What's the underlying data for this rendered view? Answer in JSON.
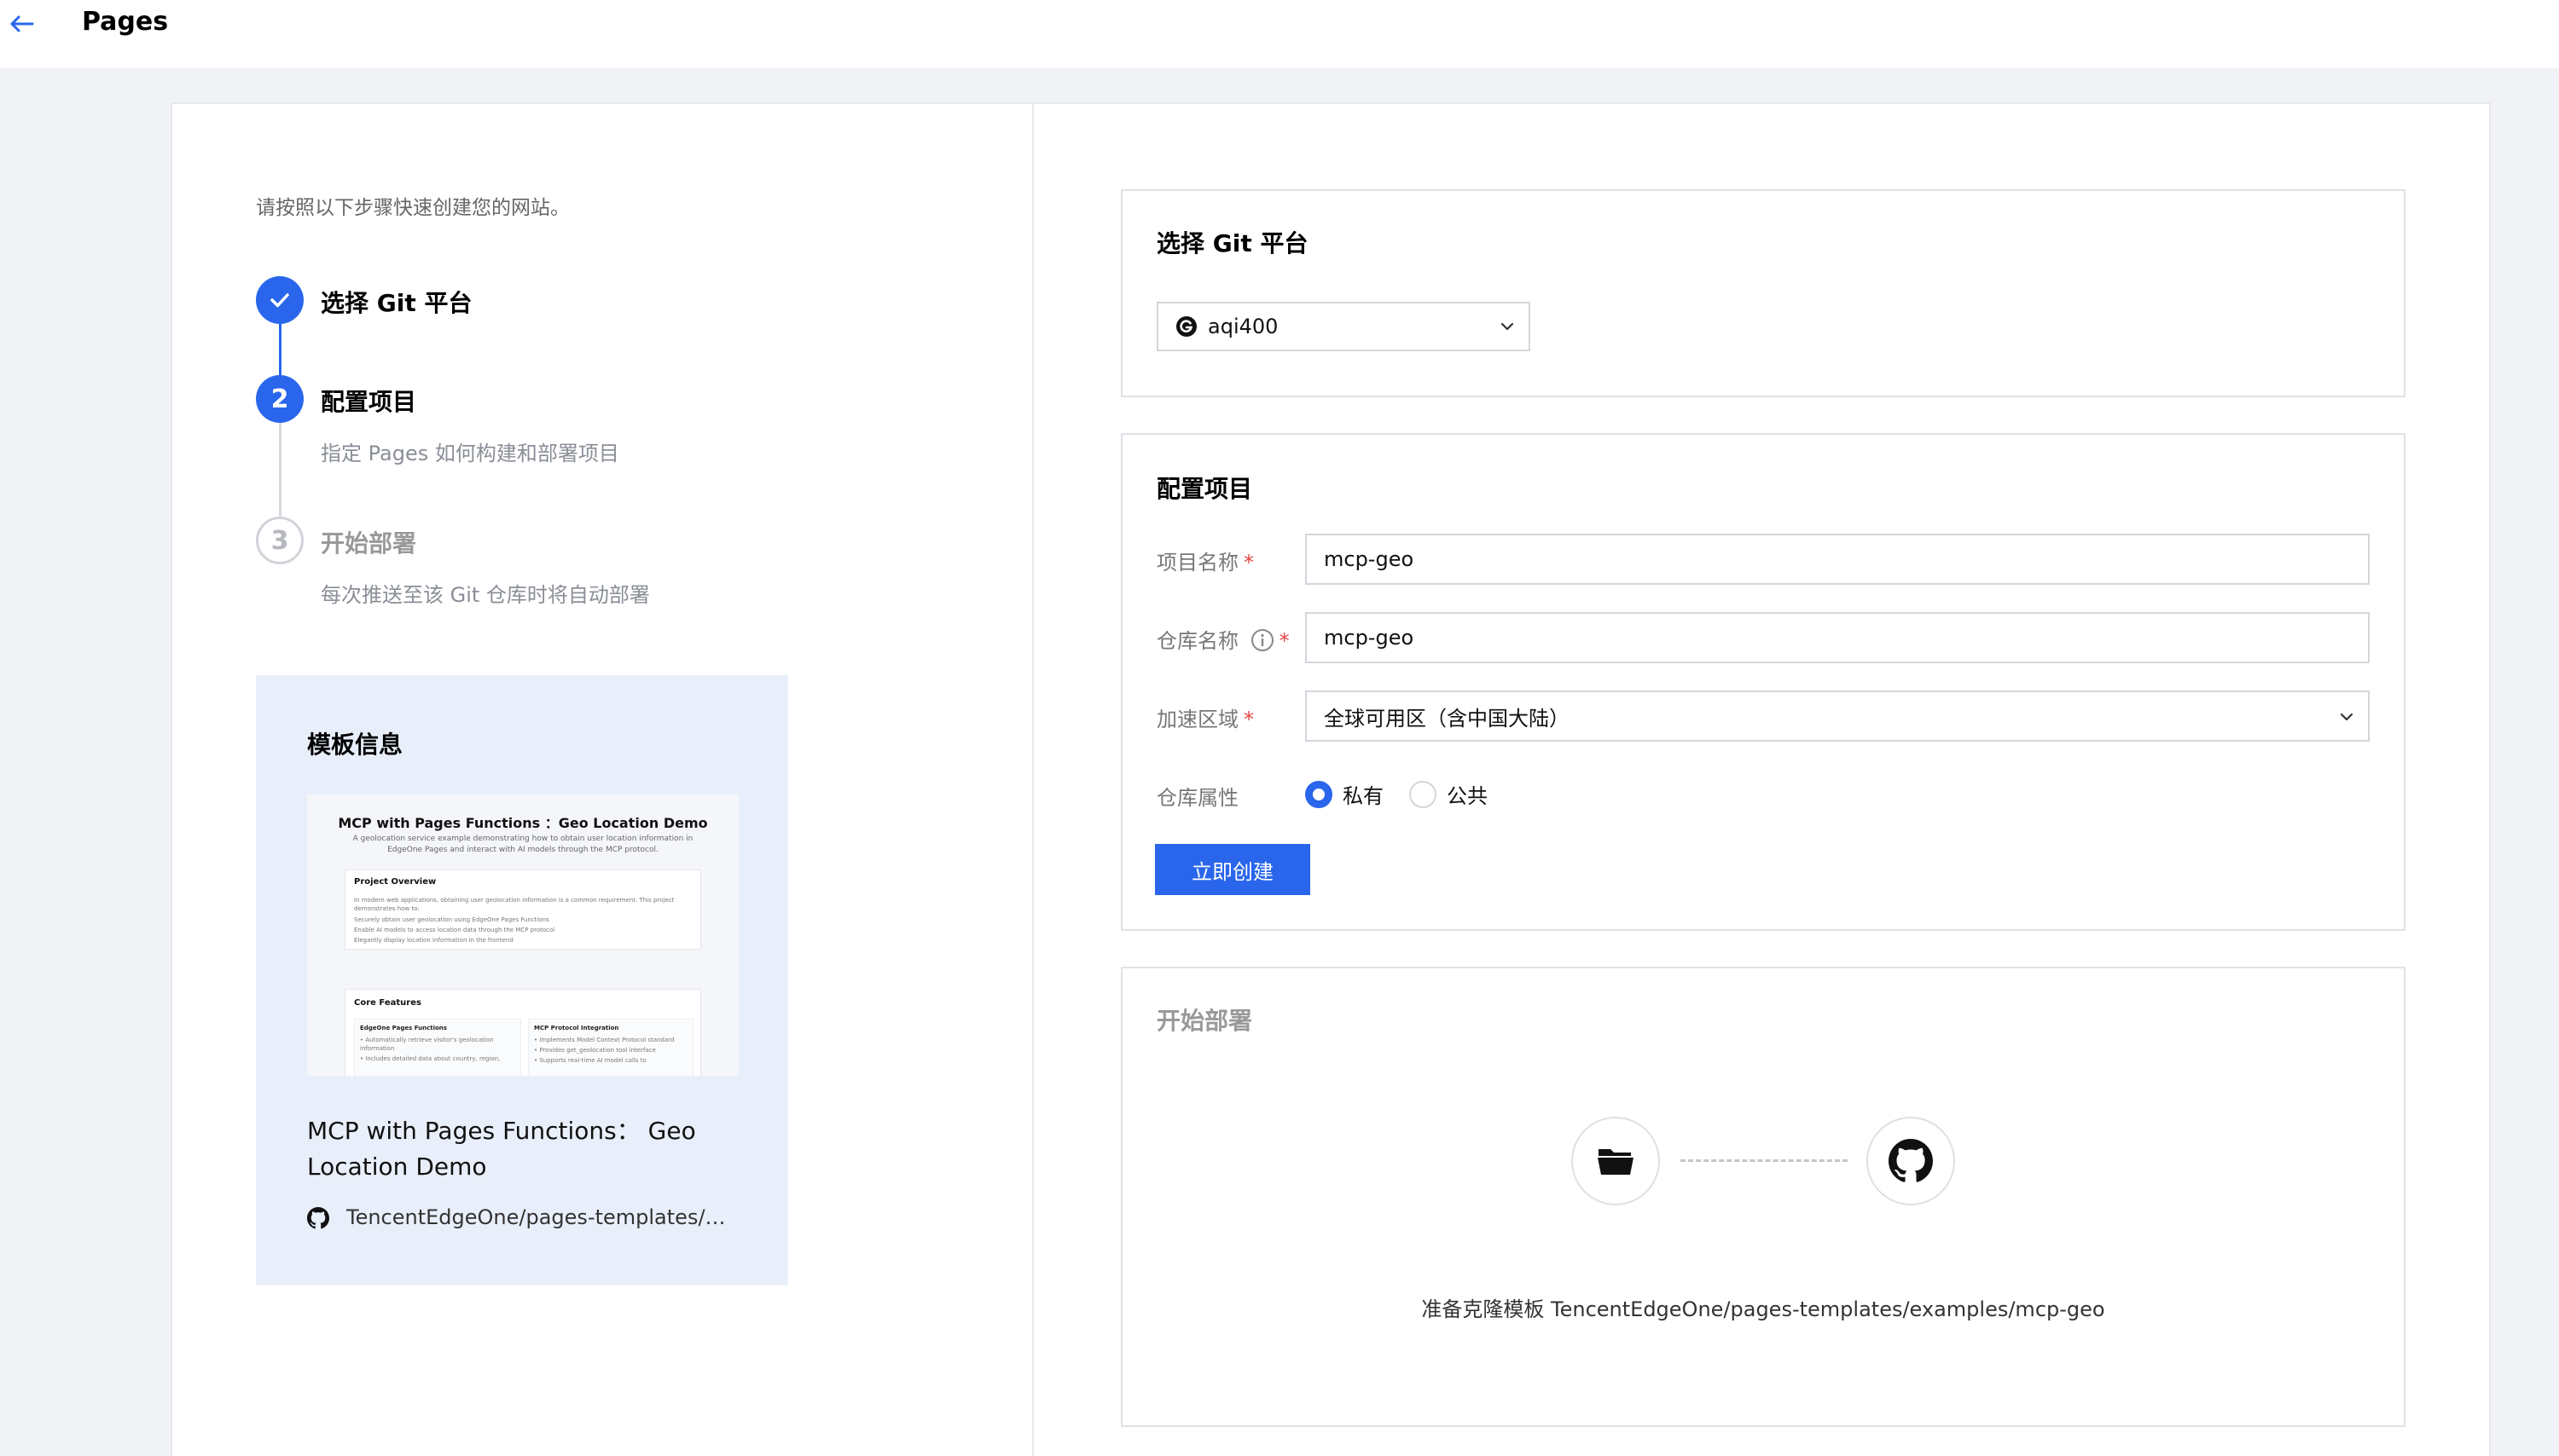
{
  "header": {
    "title": "Pages"
  },
  "intro": "请按照以下步骤快速创建您的网站。",
  "steps": [
    {
      "number": "",
      "title": "选择 Git 平台",
      "desc": "",
      "status": "done"
    },
    {
      "number": "2",
      "title": "配置项目",
      "desc": "指定 Pages 如何构建和部署项目",
      "status": "active"
    },
    {
      "number": "3",
      "title": "开始部署",
      "desc": "每次推送至该 Git 仓库时将自动部署",
      "status": "pending"
    }
  ],
  "template": {
    "heading": "模板信息",
    "name": "MCP with Pages Functions： Geo Location Demo",
    "repo": "TencentEdgeOne/pages-templates/ex...",
    "preview": {
      "title": "MCP with Pages Functions ：Geo Location Demo",
      "subtitle": "A geolocation service example demonstrating how to obtain user location information in EdgeOne Pages and interact with AI models through the MCP protocol.",
      "overview_heading": "Project Overview",
      "overview_text": "In modern web applications, obtaining user geolocation information is a common requirement. This project demonstrates how to:",
      "overview_items": [
        "Securely obtain user geolocation using EdgeOne Pages Functions",
        "Enable AI models to access location data through the MCP protocol",
        "Elegantly display location information in the frontend"
      ],
      "features_heading": "Core Features",
      "feature_left_title": "EdgeOne Pages Functions",
      "feature_left_items": [
        "• Automatically retrieve visitor's geolocation",
        "information",
        "• Includes detailed data about country, region,"
      ],
      "feature_right_title": "MCP Protocol Integration",
      "feature_right_items": [
        "• Implements Model Context Protocol standard",
        "• Provides get_geolocation tool interface",
        "• Supports real-time AI model calls to"
      ]
    }
  },
  "git_section": {
    "title": "选择 Git 平台",
    "selected_account": "aqi400"
  },
  "config_section": {
    "title": "配置项目",
    "project_name_label": "项目名称",
    "project_name_value": "mcp-geo",
    "repo_name_label": "仓库名称",
    "repo_name_value": "mcp-geo",
    "region_label": "加速区域",
    "region_value": "全球可用区（含中国大陆）",
    "visibility_label": "仓库属性",
    "visibility_options": [
      "私有",
      "公共"
    ],
    "visibility_selected": "私有",
    "required_mark": "*",
    "create_button": "立即创建"
  },
  "deploy_section": {
    "title": "开始部署",
    "message": "准备克隆模板 TencentEdgeOne/pages-templates/examples/mcp-geo"
  },
  "colors": {
    "accent": "#2a66ec",
    "required": "#e54545",
    "template_card_bg": "#e9effa"
  },
  "icons": [
    "back-arrow-icon",
    "check-icon",
    "github-icon",
    "chevron-down-icon",
    "info-icon",
    "folder-icon"
  ]
}
